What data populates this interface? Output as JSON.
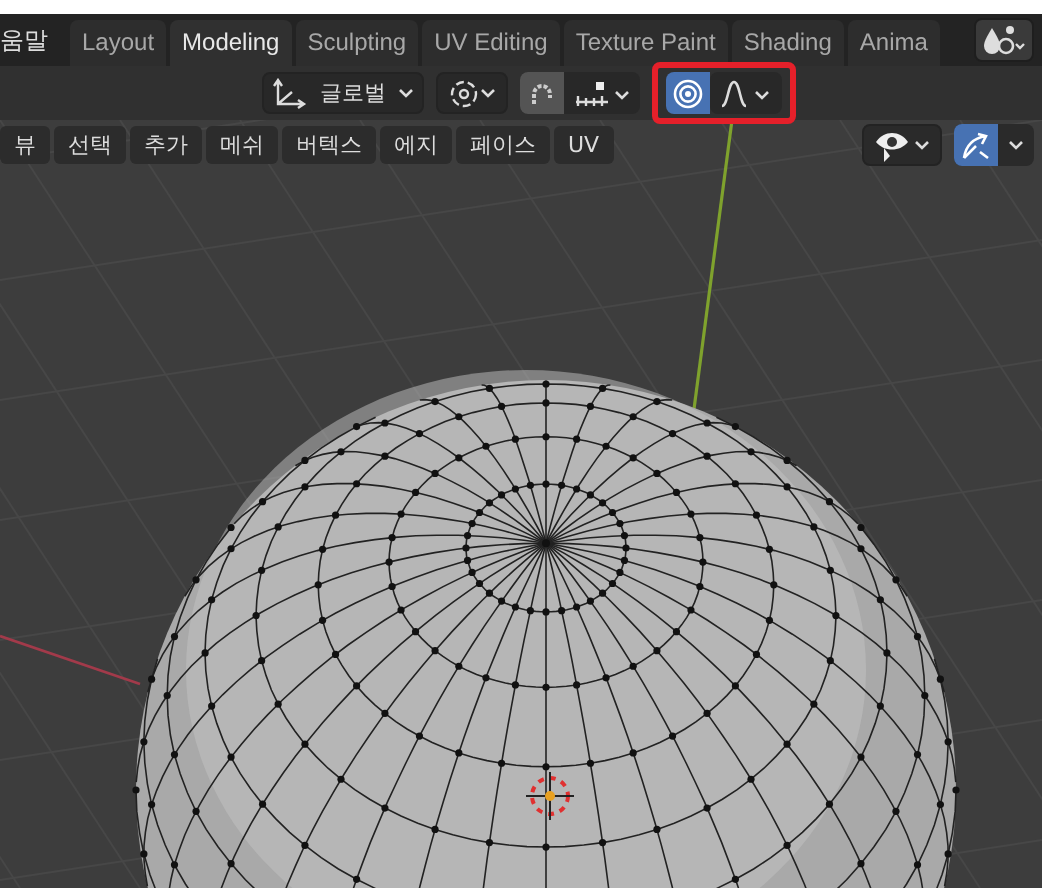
{
  "topbar": {
    "menu_partial": "움말",
    "tabs": [
      {
        "label": "Layout",
        "selected": false
      },
      {
        "label": "Modeling",
        "selected": true
      },
      {
        "label": "Sculpting",
        "selected": false
      },
      {
        "label": "UV Editing",
        "selected": false
      },
      {
        "label": "Texture Paint",
        "selected": false
      },
      {
        "label": "Shading",
        "selected": false
      },
      {
        "label": "Anima",
        "selected": false
      }
    ]
  },
  "tool_header": {
    "orientation": "글로벌",
    "snap": {
      "on": false
    },
    "proportional_editing": {
      "on": true,
      "highlighted": true
    }
  },
  "viewport": {
    "menus": [
      "뷰",
      "선택",
      "추가",
      "메쉬",
      "버텍스",
      "에지",
      "페이스",
      "UV"
    ],
    "gizmo": {
      "on": true
    }
  }
}
